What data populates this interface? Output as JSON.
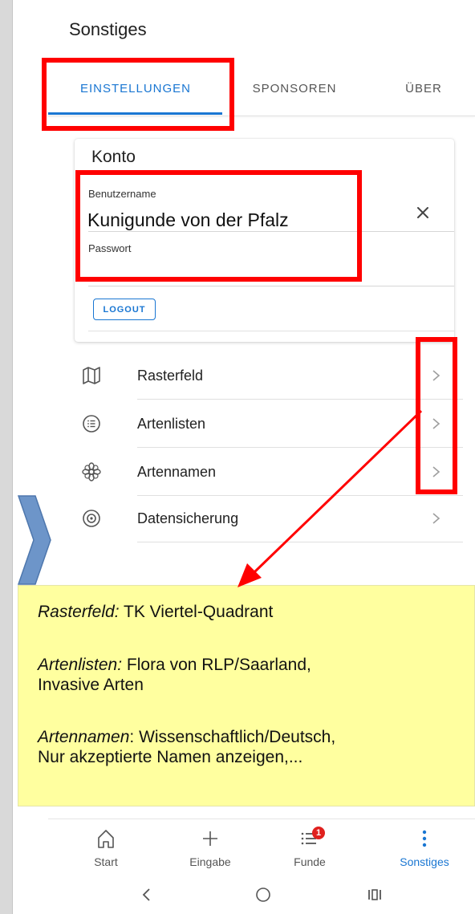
{
  "header": {
    "title": "Sonstiges"
  },
  "tabs": [
    {
      "label": "EINSTELLUNGEN",
      "active": true
    },
    {
      "label": "SPONSOREN",
      "active": false
    },
    {
      "label": "ÜBER",
      "active": false
    }
  ],
  "account": {
    "title": "Konto",
    "username_label": "Benutzername",
    "username_value": "Kunigunde von der Pfalz",
    "password_label": "Passwort",
    "logout_label": "LOGOUT"
  },
  "settings_list": [
    {
      "label": "Rasterfeld",
      "icon": "map-icon"
    },
    {
      "label": "Artenlisten",
      "icon": "list-icon"
    },
    {
      "label": "Artennamen",
      "icon": "flower-icon"
    },
    {
      "label": "Datensicherung",
      "icon": "backup-icon"
    }
  ],
  "callout": {
    "line1_key": "Rasterfeld:",
    "line1_value": " TK Viertel-Quadrant",
    "line2_key": "Artenlisten:",
    "line2_value": " Flora von RLP/Saarland,",
    "line2_cont": "Invasive Arten",
    "line3_key": "Artennamen",
    "line3_value": ": Wissenschaftlich/Deutsch,",
    "line3_cont": "Nur akzeptierte Namen anzeigen,..."
  },
  "bottom_nav": [
    {
      "label": "Start",
      "icon": "home-icon",
      "active": false
    },
    {
      "label": "Eingabe",
      "icon": "plus-icon",
      "active": false
    },
    {
      "label": "Funde",
      "icon": "list-badge-icon",
      "active": false,
      "badge": "1"
    },
    {
      "label": "Sonstiges",
      "icon": "more-vertical-icon",
      "active": true
    }
  ],
  "colors": {
    "accent": "#1976d2",
    "annotation_red": "#ff0000",
    "callout_bg": "#ffff9f",
    "badge_red": "#e0201e"
  }
}
